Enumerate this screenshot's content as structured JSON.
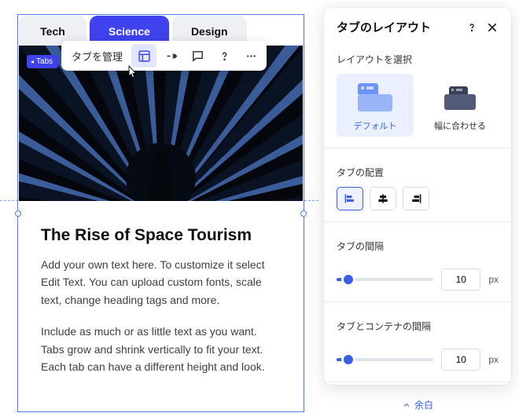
{
  "tabs": {
    "items": [
      {
        "label": "Tech",
        "active": false
      },
      {
        "label": "Science",
        "active": true
      },
      {
        "label": "Design",
        "active": false
      }
    ],
    "badge_label": "Tabs"
  },
  "toolbar": {
    "manage_label": "タブを管理"
  },
  "article": {
    "heading": "The Rise of Space Tourism",
    "p1": "Add your own text here. To customize it select Edit Text. You can upload custom fonts, scale text, change heading tags and more.",
    "p2": "Include as much or as little text as you want. Tabs grow and shrink vertically to fit your text. Each tab can have a different height and look."
  },
  "panel": {
    "title": "タブのレイアウト",
    "section_layout": "レイアウトを選択",
    "layout_default": "デフォルト",
    "layout_fit": "幅に合わせる",
    "section_align": "タブの配置",
    "section_tab_gap": "タブの間隔",
    "section_container_gap": "タブとコンテナの間隔",
    "tab_gap_value": "10",
    "container_gap_value": "10",
    "unit": "px",
    "footer": "余白"
  },
  "colors": {
    "accent": "#3f42ed",
    "link": "#3960e4"
  }
}
